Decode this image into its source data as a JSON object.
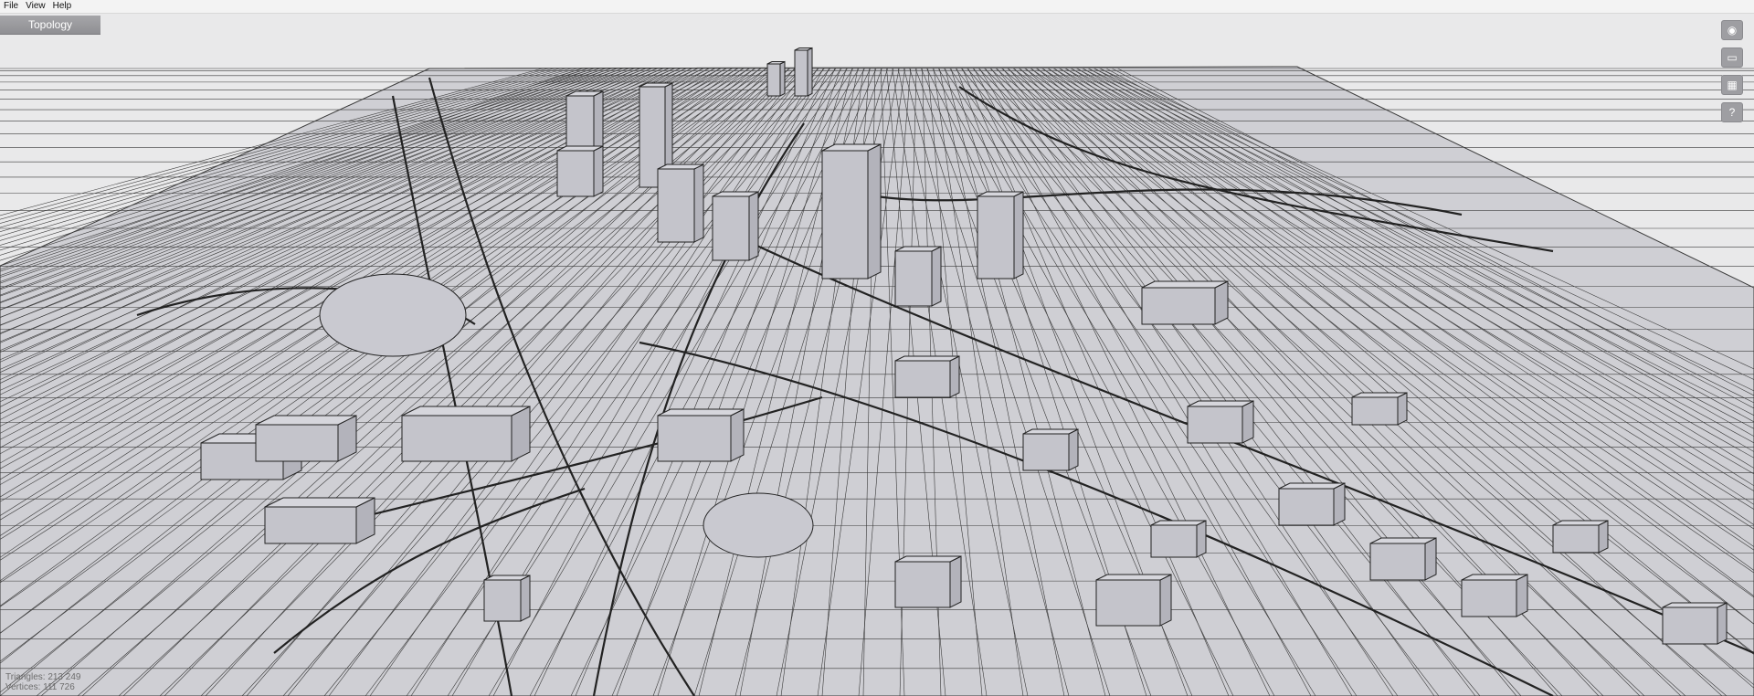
{
  "menu": {
    "items": [
      {
        "label": "File"
      },
      {
        "label": "View"
      },
      {
        "label": "Help"
      }
    ]
  },
  "tab": {
    "label": "Topology"
  },
  "toolbar": {
    "icons": [
      {
        "name": "globe-icon",
        "glyph": "◉"
      },
      {
        "name": "window-icon",
        "glyph": "▭"
      },
      {
        "name": "texture-icon",
        "glyph": "▦"
      },
      {
        "name": "help-icon",
        "glyph": "?"
      }
    ]
  },
  "status": {
    "line1": "Triangles: 213 249",
    "line2": "Vertices: 111 726"
  },
  "colors": {
    "background": "#e9e9ea",
    "mesh": "#cbcbd0",
    "wire": "#2a2a2a",
    "building": "#c8c8cf"
  }
}
